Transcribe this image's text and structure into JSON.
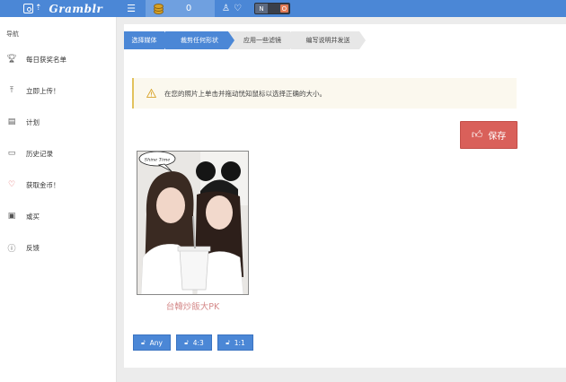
{
  "topbar": {
    "app_name": "Gramblr",
    "coin_count": "0",
    "toggle_left": "N",
    "toggle_right": "O"
  },
  "sidebar": {
    "heading": "导航",
    "items": [
      {
        "label": "每日获奖名单",
        "icon": "trophy-icon"
      },
      {
        "label": "立即上传！",
        "icon": "upload-icon"
      },
      {
        "label": "计划",
        "icon": "calendar-icon"
      },
      {
        "label": "历史记录",
        "icon": "history-icon"
      },
      {
        "label": "获取金币！",
        "icon": "heart-icon"
      },
      {
        "label": "或买",
        "icon": "buy-icon"
      },
      {
        "label": "反馈",
        "icon": "help-icon"
      }
    ]
  },
  "steps": [
    {
      "label": "选择媒体",
      "active": true
    },
    {
      "label": "裁剪任何形状",
      "active": true
    },
    {
      "label": "应用一些滤镜",
      "active": false
    },
    {
      "label": "编写说明并发送",
      "active": false
    }
  ],
  "alert": {
    "text": "在您的照片上单击并拖动恍知鼠标以选择正确的大小。"
  },
  "save_button": {
    "label": "保存"
  },
  "photo": {
    "bubble_text": "Shine Time",
    "caption": "台韓炒飯大PK"
  },
  "ratio_buttons": [
    {
      "label": "Any"
    },
    {
      "label": "4:3"
    },
    {
      "label": "1:1"
    }
  ],
  "colors": {
    "primary": "#4b87d6",
    "danger": "#d9605a",
    "warning_border": "#e2c25d",
    "caption": "#d58b8b"
  }
}
